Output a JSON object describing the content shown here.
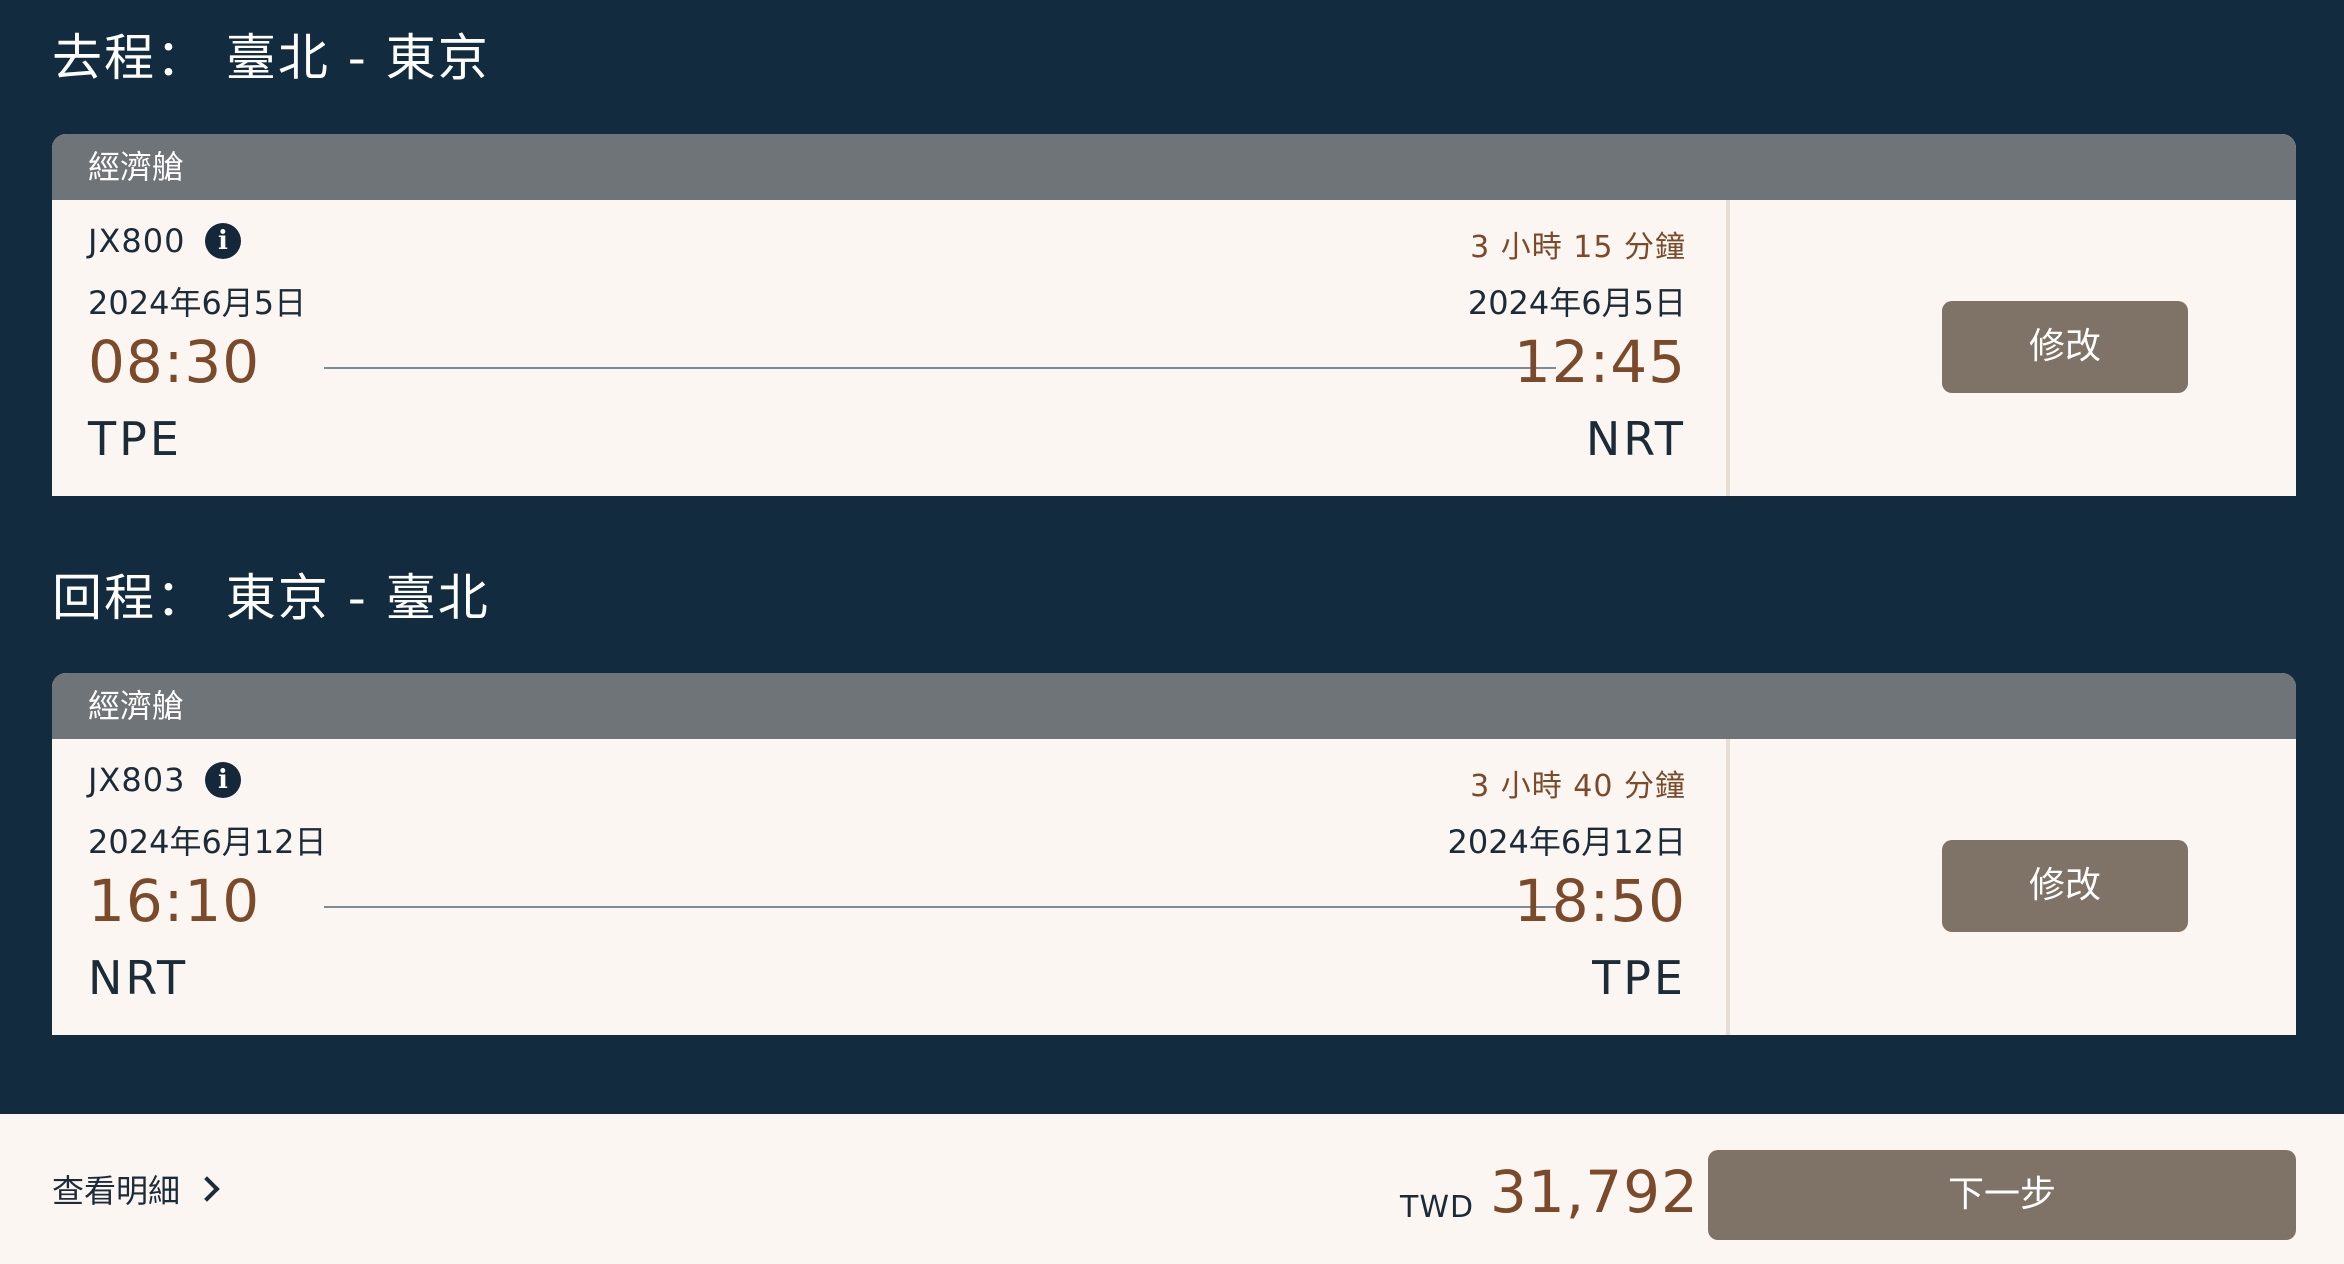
{
  "outbound": {
    "title": "去程： 臺北 - 東京",
    "cabin": "經濟艙",
    "flight_no": "JX800",
    "duration": "3 小時 15 分鐘",
    "dep_date": "2024年6月5日",
    "arr_date": "2024年6月5日",
    "dep_time": "08:30",
    "arr_time": "12:45",
    "dep_code": "TPE",
    "arr_code": "NRT",
    "modify_label": "修改"
  },
  "return": {
    "title": "回程： 東京 - 臺北",
    "cabin": "經濟艙",
    "flight_no": "JX803",
    "duration": "3 小時 40 分鐘",
    "dep_date": "2024年6月12日",
    "arr_date": "2024年6月12日",
    "dep_time": "16:10",
    "arr_time": "18:50",
    "dep_code": "NRT",
    "arr_code": "TPE",
    "modify_label": "修改"
  },
  "footer": {
    "details_label": "查看明細",
    "currency": "TWD",
    "total": "31,792",
    "next_label": "下一步"
  },
  "icons": {
    "flight_info": "info-icon",
    "details": "chevron-right-icon"
  },
  "colors": {
    "background": "#122b3e",
    "card": "#fcf6f2",
    "cabin_bar": "#6f7479",
    "accent_text": "#7b4a2a",
    "button": "#7f7266"
  }
}
